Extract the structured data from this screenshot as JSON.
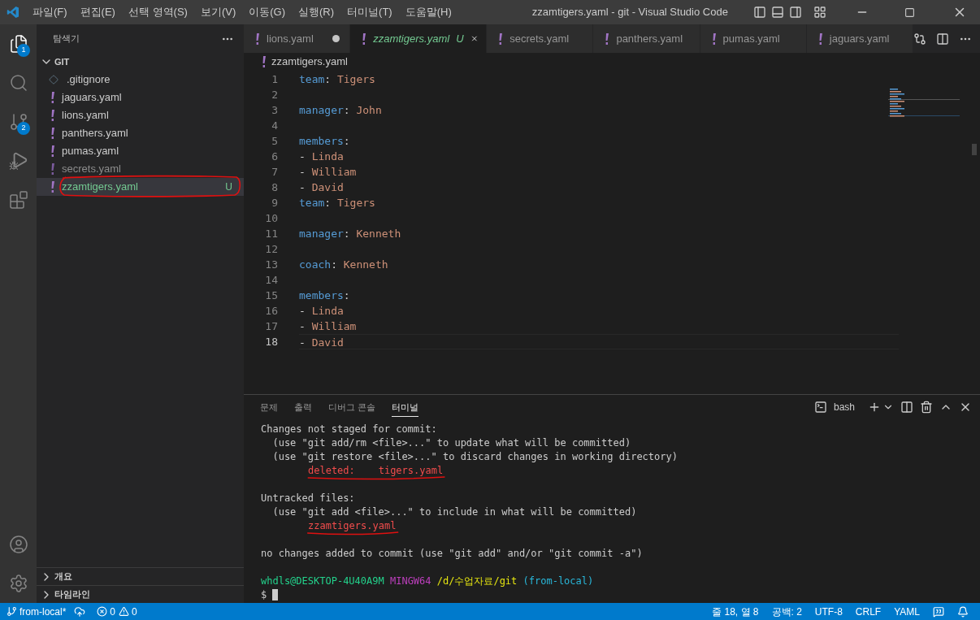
{
  "window": {
    "title": "zzamtigers.yaml - git - Visual Studio Code"
  },
  "menu": [
    "파일(F)",
    "편집(E)",
    "선택 영역(S)",
    "보기(V)",
    "이동(G)",
    "실행(R)",
    "터미널(T)",
    "도움말(H)"
  ],
  "activity_bar": [
    {
      "kind": "explorer",
      "selected": true,
      "badge": "1"
    },
    {
      "kind": "search",
      "selected": false
    },
    {
      "kind": "source-control",
      "selected": false,
      "badge": "2"
    },
    {
      "kind": "run",
      "selected": false
    },
    {
      "kind": "extensions",
      "selected": false
    }
  ],
  "explorer": {
    "title": "탐색기",
    "folder": {
      "label": "GIT",
      "expanded": true
    },
    "files": [
      {
        "name": ".gitignore",
        "kind": "ignore",
        "selected": false,
        "ignored": false,
        "untracked": false
      },
      {
        "name": "jaguars.yaml",
        "kind": "yaml",
        "selected": false,
        "ignored": false,
        "untracked": false
      },
      {
        "name": "lions.yaml",
        "kind": "yaml",
        "selected": false,
        "ignored": false,
        "untracked": false
      },
      {
        "name": "panthers.yaml",
        "kind": "yaml",
        "selected": false,
        "ignored": false,
        "untracked": false
      },
      {
        "name": "pumas.yaml",
        "kind": "yaml",
        "selected": false,
        "ignored": false,
        "untracked": false
      },
      {
        "name": "secrets.yaml",
        "kind": "yaml",
        "selected": false,
        "ignored": true,
        "untracked": false
      },
      {
        "name": "zzamtigers.yaml",
        "kind": "yaml",
        "selected": true,
        "ignored": false,
        "untracked": true,
        "status": "U",
        "circled": true
      }
    ],
    "sections": [
      {
        "label": "개요",
        "expanded": false
      },
      {
        "label": "타임라인",
        "expanded": false
      }
    ]
  },
  "tabs": [
    {
      "label": "lions.yaml",
      "selected": false,
      "dirty": true,
      "preview": false
    },
    {
      "label": "zzamtigers.yaml",
      "selected": true,
      "dirty": false,
      "preview": true,
      "status": "U"
    },
    {
      "label": "secrets.yaml",
      "selected": false,
      "dirty": false,
      "preview": false
    },
    {
      "label": "panthers.yaml",
      "selected": false,
      "dirty": false,
      "preview": false
    },
    {
      "label": "pumas.yaml",
      "selected": false,
      "dirty": false,
      "preview": false
    },
    {
      "label": "jaguars.yaml",
      "selected": false,
      "dirty": false,
      "preview": false
    }
  ],
  "breadcrumb": "zzamtigers.yaml",
  "code": [
    {
      "number": "1",
      "current": false,
      "tokens": [
        {
          "text": "team",
          "kind": "key"
        },
        {
          "text": ": ",
          "kind": "punct"
        },
        {
          "text": "Tigers",
          "kind": "value"
        }
      ]
    },
    {
      "number": "2",
      "current": false
    },
    {
      "number": "3",
      "current": false,
      "tokens": [
        {
          "text": "manager",
          "kind": "key"
        },
        {
          "text": ": ",
          "kind": "punct"
        },
        {
          "text": "John",
          "kind": "value"
        }
      ]
    },
    {
      "number": "4",
      "current": false
    },
    {
      "number": "5",
      "current": false,
      "tokens": [
        {
          "text": "members",
          "kind": "key"
        },
        {
          "text": ":",
          "kind": "punct"
        }
      ]
    },
    {
      "number": "6",
      "current": false,
      "tokens": [
        {
          "text": "- ",
          "kind": "punct"
        },
        {
          "text": "Linda",
          "kind": "value"
        }
      ]
    },
    {
      "number": "7",
      "current": false,
      "tokens": [
        {
          "text": "- ",
          "kind": "punct"
        },
        {
          "text": "William",
          "kind": "value"
        }
      ]
    },
    {
      "number": "8",
      "current": false,
      "tokens": [
        {
          "text": "- ",
          "kind": "punct"
        },
        {
          "text": "David",
          "kind": "value"
        }
      ]
    },
    {
      "number": "9",
      "current": false,
      "tokens": [
        {
          "text": "team",
          "kind": "key"
        },
        {
          "text": ": ",
          "kind": "punct"
        },
        {
          "text": "Tigers",
          "kind": "value"
        }
      ]
    },
    {
      "number": "10",
      "current": false
    },
    {
      "number": "11",
      "current": false,
      "tokens": [
        {
          "text": "manager",
          "kind": "key"
        },
        {
          "text": ": ",
          "kind": "punct"
        },
        {
          "text": "Kenneth",
          "kind": "value"
        }
      ]
    },
    {
      "number": "12",
      "current": false
    },
    {
      "number": "13",
      "current": false,
      "tokens": [
        {
          "text": "coach",
          "kind": "key"
        },
        {
          "text": ": ",
          "kind": "punct"
        },
        {
          "text": "Kenneth",
          "kind": "value"
        }
      ]
    },
    {
      "number": "14",
      "current": false
    },
    {
      "number": "15",
      "current": false,
      "tokens": [
        {
          "text": "members",
          "kind": "key"
        },
        {
          "text": ":",
          "kind": "punct"
        }
      ]
    },
    {
      "number": "16",
      "current": false,
      "tokens": [
        {
          "text": "- ",
          "kind": "punct"
        },
        {
          "text": "Linda",
          "kind": "value"
        }
      ]
    },
    {
      "number": "17",
      "current": false,
      "tokens": [
        {
          "text": "- ",
          "kind": "punct"
        },
        {
          "text": "William",
          "kind": "value"
        }
      ]
    },
    {
      "number": "18",
      "current": true,
      "tokens": [
        {
          "text": "- ",
          "kind": "punct"
        },
        {
          "text": "David",
          "kind": "value"
        }
      ]
    }
  ],
  "panel": {
    "tabs": [
      {
        "label": "문제",
        "selected": false
      },
      {
        "label": "출력",
        "selected": false
      },
      {
        "label": "디버그 콘솔",
        "selected": false
      },
      {
        "label": "터미널",
        "selected": true
      }
    ],
    "shell": "bash",
    "terminal": [
      {
        "tokens": [
          {
            "text": "Changes not staged for commit:",
            "kind": "plain"
          }
        ]
      },
      {
        "tokens": [
          {
            "text": "  (use \"git add/rm <file>...\" to update what will be committed)",
            "kind": "plain"
          }
        ]
      },
      {
        "tokens": [
          {
            "text": "  (use \"git restore <file>...\" to discard changes in working directory)",
            "kind": "plain"
          }
        ]
      },
      {
        "indented": true,
        "tokens": [
          {
            "text": "deleted:    tigers.yaml",
            "kind": "deleted",
            "underlined": true
          }
        ]
      },
      {
        "kind": "blank"
      },
      {
        "tokens": [
          {
            "text": "Untracked files:",
            "kind": "plain"
          }
        ]
      },
      {
        "tokens": [
          {
            "text": "  (use \"git add <file>...\" to include in what will be committed)",
            "kind": "plain"
          }
        ]
      },
      {
        "indented": true,
        "tokens": [
          {
            "text": "zzamtigers.yaml",
            "kind": "deleted",
            "underlined": true
          }
        ]
      },
      {
        "kind": "blank"
      },
      {
        "tokens": [
          {
            "text": "no changes added to commit (use \"git add\" and/or \"git commit -a\")",
            "kind": "plain"
          }
        ]
      },
      {
        "kind": "blank"
      },
      {
        "tokens": [
          {
            "text": "whdls@DESKTOP-4U40A9M ",
            "kind": "user"
          },
          {
            "text": "MINGW64 ",
            "kind": "host"
          },
          {
            "text": "/d/수업자료/git ",
            "kind": "path"
          },
          {
            "text": "(from-local)",
            "kind": "branch"
          }
        ]
      },
      {
        "tokens": [
          {
            "text": "$ ",
            "kind": "plain"
          }
        ],
        "cursor": true
      }
    ]
  },
  "status_bar": {
    "branch": "from-local*",
    "errors": "0",
    "warnings": "0",
    "right": [
      "줄 18, 열 8",
      "공백: 2",
      "UTF-8",
      "CRLF",
      "YAML"
    ]
  }
}
